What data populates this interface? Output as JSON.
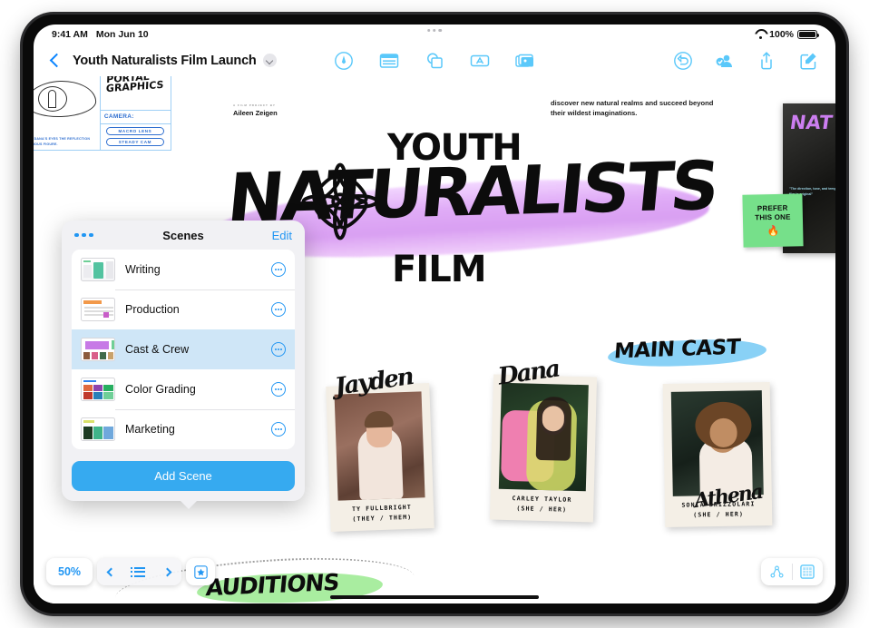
{
  "status_bar": {
    "time": "9:41 AM",
    "date": "Mon Jun 10",
    "battery_pct": "100%",
    "wifi_icon": "wifi-icon",
    "battery_icon": "battery-icon"
  },
  "nav": {
    "back_icon": "back-chevron-icon",
    "document_title": "Youth Naturalists Film Launch",
    "title_menu_icon": "chevron-down-icon",
    "center_tools": [
      {
        "name": "draw-tool",
        "icon": "pen-circle-icon"
      },
      {
        "name": "table-tool",
        "icon": "table-icon"
      },
      {
        "name": "shapes-tool",
        "icon": "shapes-icon"
      },
      {
        "name": "text-tool",
        "icon": "text-box-icon"
      },
      {
        "name": "media-tool",
        "icon": "media-icon"
      }
    ],
    "right_tools": [
      {
        "name": "undo-button",
        "icon": "undo-icon"
      },
      {
        "name": "collaborate-button",
        "icon": "person-badge-icon"
      },
      {
        "name": "share-button",
        "icon": "share-icon"
      },
      {
        "name": "compose-button",
        "icon": "compose-icon"
      }
    ]
  },
  "canvas": {
    "storyboard": {
      "portal_graphics": "PORTAL\nGRAPHICS",
      "camera_label": "CAMERA:",
      "pills": [
        "MACRO LENS",
        "STEADY CAM"
      ],
      "note": "EN ON DANA'S EYES\nTHE REFLECTION\nYSTERIOUS FIGURE."
    },
    "author": {
      "kicker": "A FILM PROJECT BY",
      "name": "Aileen Zeigen"
    },
    "blurb": "discover new natural realms and succeed beyond their wildest imaginations.",
    "title_line1": "YOUTH",
    "title_line2": "NATURALISTS",
    "title_line3": "FILM",
    "poster": {
      "text": "NAT",
      "caption": "\"The direction, tone, and tempo of the film is original\""
    },
    "sticky_note": {
      "text": "PREFER\nTHIS ONE",
      "emoji": "🔥",
      "color": "#76e08a"
    },
    "cast_heading": "MAIN CAST",
    "auditions_text": "AUDITIONS",
    "cast": [
      {
        "signature": "Jayden",
        "name": "TY FULLBRIGHT",
        "pronouns": "(THEY / THEM)"
      },
      {
        "signature": "Dana",
        "name": "CARLEY TAYLOR",
        "pronouns": "(SHE / HER)"
      },
      {
        "signature": "Athena",
        "name": "SONIA BRIZZOLARI",
        "pronouns": "(SHE / HER)"
      }
    ]
  },
  "scenes_popover": {
    "menu_icon": "more-dots-icon",
    "title": "Scenes",
    "edit_label": "Edit",
    "items": [
      {
        "label": "Writing",
        "selected": false,
        "info_icon": "info-ellipsis-icon"
      },
      {
        "label": "Production",
        "selected": false,
        "info_icon": "info-ellipsis-icon"
      },
      {
        "label": "Cast & Crew",
        "selected": true,
        "info_icon": "info-ellipsis-icon"
      },
      {
        "label": "Color Grading",
        "selected": false,
        "info_icon": "info-ellipsis-icon"
      },
      {
        "label": "Marketing",
        "selected": false,
        "info_icon": "info-ellipsis-icon"
      }
    ],
    "add_scene_label": "Add Scene"
  },
  "bottom_bar": {
    "zoom_level": "50%",
    "prev_icon": "chevron-left-icon",
    "list_icon": "scene-list-icon",
    "next_icon": "chevron-right-icon",
    "star_icon": "star-box-icon",
    "right_buttons": [
      {
        "name": "connections-view-button",
        "icon": "node-graph-icon",
        "selected": false
      },
      {
        "name": "canvas-view-button",
        "icon": "grid-canvas-icon",
        "selected": true
      }
    ]
  },
  "colors": {
    "accent": "#2196f3",
    "tool_blue": "#5ac8fa",
    "selection": "#cfe6f7",
    "sticky_green": "#76e08a",
    "swash_purple": "#d89bf2",
    "swash_blue": "#74c9f5",
    "swash_green": "#a9eda0"
  }
}
